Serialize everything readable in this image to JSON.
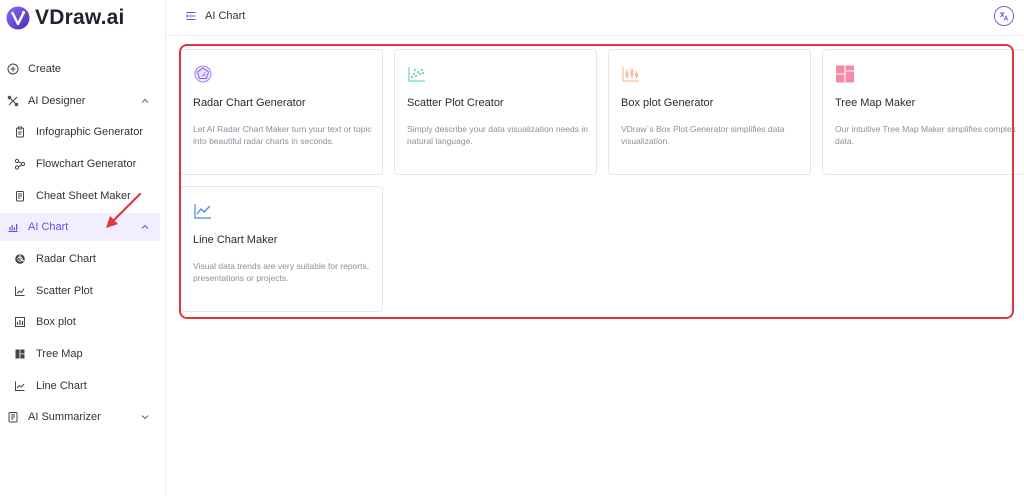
{
  "app": {
    "name": "VDraw.ai"
  },
  "header": {
    "title": "AI Chart"
  },
  "sidebar": {
    "items": [
      {
        "label": "Create"
      },
      {
        "label": "AI Designer"
      },
      {
        "label": "Infographic Generator"
      },
      {
        "label": "Flowchart Generator"
      },
      {
        "label": "Cheat Sheet Maker"
      },
      {
        "label": "AI Chart"
      },
      {
        "label": "Radar Chart"
      },
      {
        "label": "Scatter Plot"
      },
      {
        "label": "Box plot"
      },
      {
        "label": "Tree Map"
      },
      {
        "label": "Line Chart"
      },
      {
        "label": "AI Summarizer"
      }
    ]
  },
  "cards": [
    {
      "title": "Radar Chart Generator",
      "desc": "Let AI Radar Chart Maker turn your text or topic into beautiful radar charts in seconds."
    },
    {
      "title": "Scatter Plot Creator",
      "desc": "Simply describe your data visualization needs in natural language."
    },
    {
      "title": "Box plot Generator",
      "desc": "VDraw`s Box Plot Generator simplifies data visualization."
    },
    {
      "title": "Tree Map Maker",
      "desc": "Our intuitive Tree Map Maker simplifies complex data."
    },
    {
      "title": "Line Chart Maker",
      "desc": "Visual data trends are very suitable for reports, presentations or projects."
    }
  ],
  "colors": {
    "accent": "#6b4ee6",
    "active_bg": "#f1efff",
    "highlight": "#e0353b"
  }
}
